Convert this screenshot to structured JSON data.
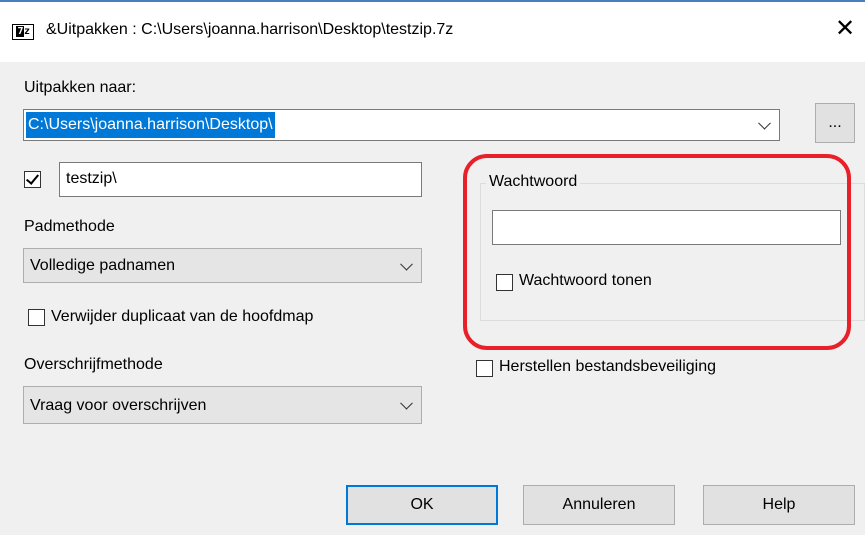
{
  "window": {
    "icon_text": "7z",
    "title": "&Uitpakken : C:\\Users\\joanna.harrison\\Desktop\\testzip.7z",
    "close_symbol": "✕"
  },
  "extract": {
    "label": "Uitpakken naar:",
    "path_value": "C:\\Users\\joanna.harrison\\Desktop\\",
    "browse_label": "..."
  },
  "subfolder": {
    "checked": true,
    "value": "testzip\\"
  },
  "path_mode": {
    "label": "Padmethode",
    "selected": "Volledige padnamen"
  },
  "remove_duplicate": {
    "checked": false,
    "label": "Verwijder duplicaat van de hoofdmap"
  },
  "overwrite_mode": {
    "label": "Overschrijfmethode",
    "selected": "Vraag voor overschrijven"
  },
  "password": {
    "group_label": "Wachtwoord",
    "value": "",
    "show_checked": false,
    "show_label": "Wachtwoord tonen"
  },
  "restore_security": {
    "checked": false,
    "label": "Herstellen bestandsbeveiliging"
  },
  "buttons": {
    "ok": "OK",
    "cancel": "Annuleren",
    "help": "Help"
  },
  "colors": {
    "selection": "#0078d7",
    "highlight": "#e8202a",
    "title_accent": "#4a7fbf"
  }
}
